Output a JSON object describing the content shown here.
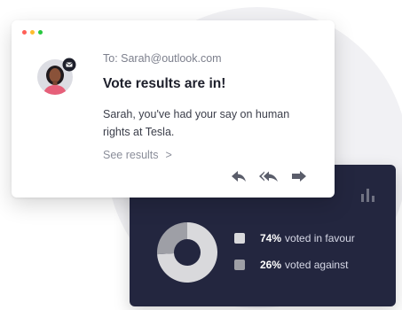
{
  "email": {
    "to": "To: Sarah@outlook.com",
    "subject": "Vote results are in!",
    "body": "Sarah, you've had your say on human rights at Tesla.",
    "link": "See results",
    "link_chevron": ">",
    "window_dots": [
      "#ff5f57",
      "#febc2e",
      "#28c840"
    ],
    "actions": [
      "reply-icon",
      "reply-all-icon",
      "forward-icon"
    ]
  },
  "results": {
    "items": [
      {
        "percent": "74%",
        "label": "voted in favour",
        "value": 74,
        "color": "#d9d9dc"
      },
      {
        "percent": "26%",
        "label": "voted against",
        "value": 26,
        "color": "#9e9fa6"
      }
    ],
    "icon": "bar-chart-icon"
  }
}
